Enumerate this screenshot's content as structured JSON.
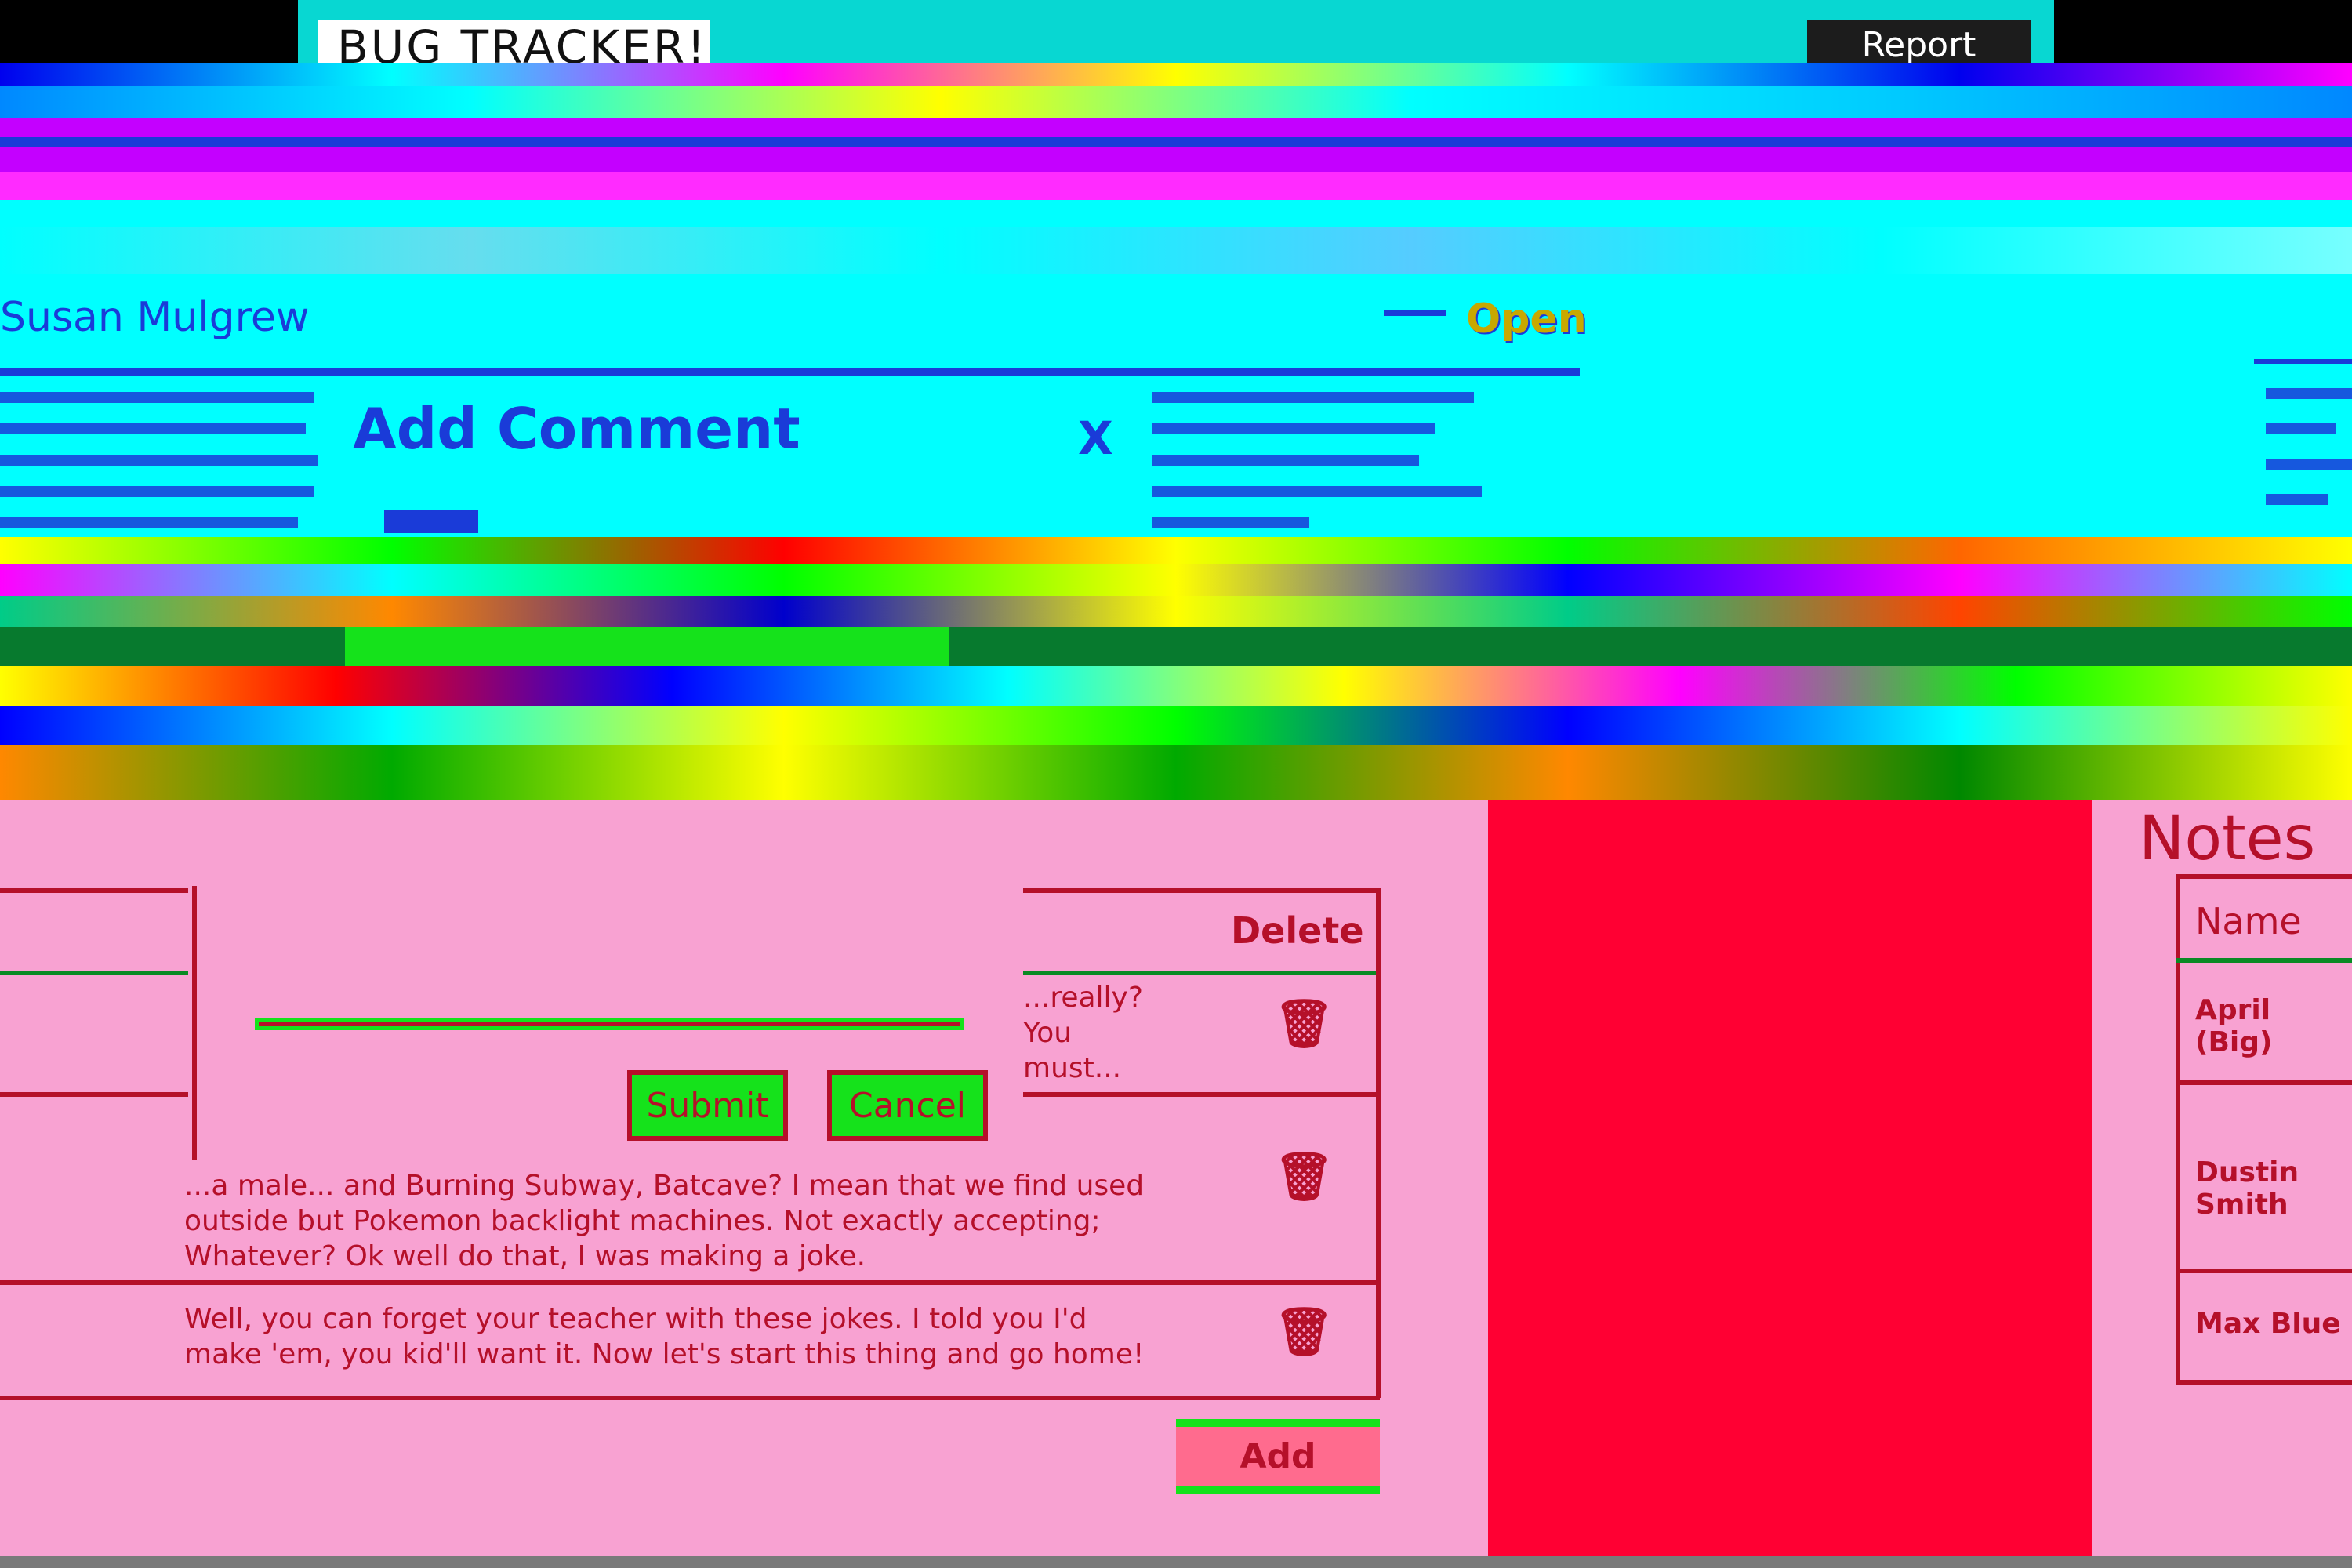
{
  "header": {
    "logo_text": "BUG TRACKER!",
    "report_button": "Report"
  },
  "issue": {
    "reporter": "Susan Mulgrew",
    "status": "Open"
  },
  "modal": {
    "title": "Add Comment",
    "close_label": "X",
    "submit_label": "Submit",
    "cancel_label": "Cancel"
  },
  "comments": {
    "delete_header": "Delete",
    "rows": [
      {
        "text": "...really? You must...",
        "trash": "🗑"
      },
      {
        "text": "...a male... and Burning Subway, Batcave? I mean that we find used outside but Pokemon backlight machines. Not exactly accepting; Whatever? Ok well do that, I was making a joke.",
        "trash": "🗑"
      },
      {
        "text": "Well, you can forget your teacher with these jokes. I told you I'd make 'em, you kid'll want it. Now let's start this thing and go home!",
        "trash": "🗑"
      }
    ],
    "add_label": "Add"
  },
  "notes": {
    "title": "Notes",
    "name_header": "Name",
    "items": [
      "April (Big)",
      "Dustin Smith",
      "Max Blue"
    ]
  },
  "colors": {
    "header_bg": "#08d7d2",
    "cyan": "#00ffff",
    "blue": "#1a3bd8",
    "pink": "#f8a2d2",
    "red": "#ff0033",
    "dark_red": "#b5102a",
    "green": "#15e21b"
  }
}
